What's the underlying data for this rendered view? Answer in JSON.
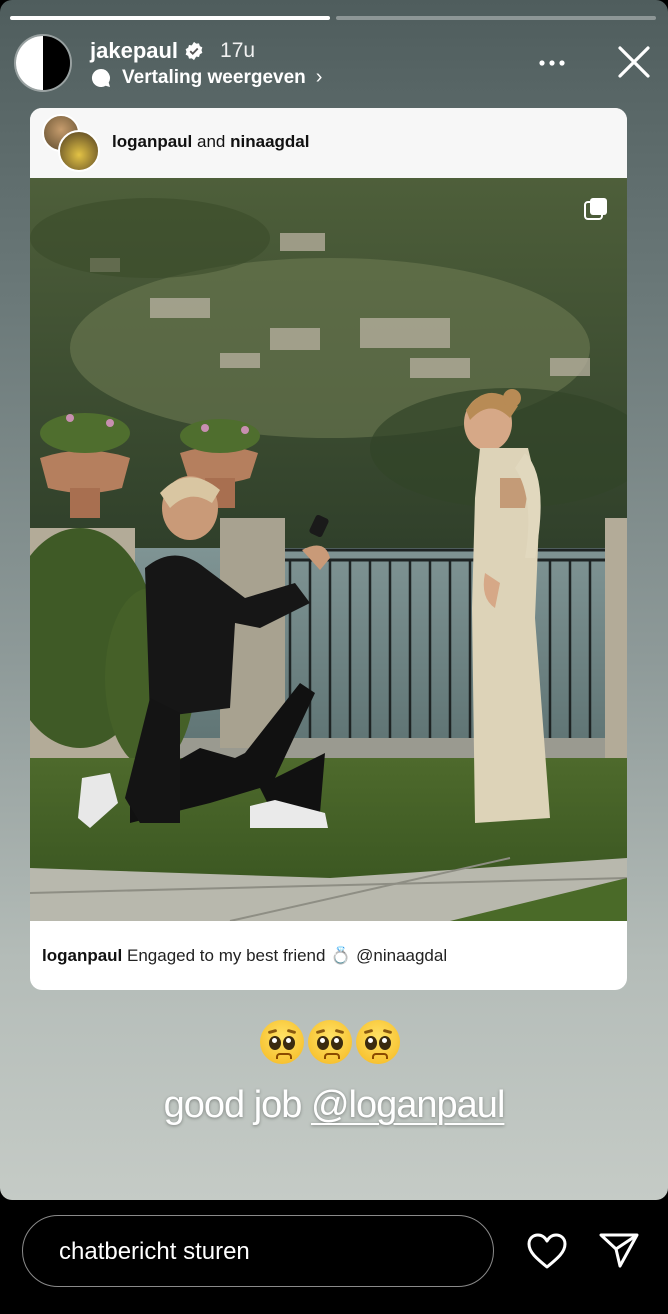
{
  "story": {
    "progress": [
      true,
      false
    ],
    "username": "jakepaul",
    "time": "17u",
    "translate_label": "Vertaling weergeven",
    "chevron": "›"
  },
  "post": {
    "coauthor1": "loganpaul",
    "and_word": "and",
    "coauthor2": "ninaagdal",
    "caption_user": "loganpaul",
    "caption_text": "Engaged to my best friend",
    "caption_emoji": "💍",
    "caption_mention": "@ninaagdal"
  },
  "overlay": {
    "emoji_count": 3,
    "text_prefix": "good job",
    "text_mention": "@loganpaul"
  },
  "bottom": {
    "message_placeholder": "chatbericht sturen"
  },
  "icons": {
    "verified": "verified-badge-icon",
    "translate": "translate-bubble-icon",
    "more": "more-dots-icon",
    "close": "close-x-icon",
    "multi": "multiple-photos-icon",
    "heart": "heart-icon",
    "send": "send-paper-plane-icon"
  }
}
